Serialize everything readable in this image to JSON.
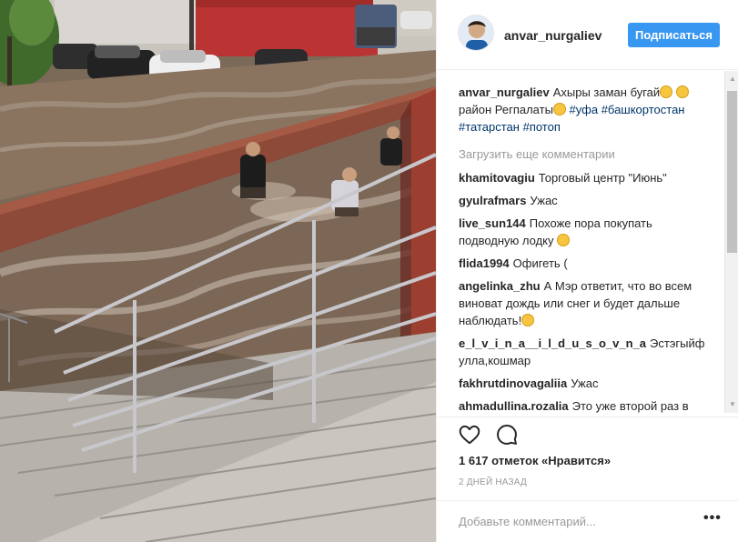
{
  "post": {
    "username": "anvar_nurgaliev",
    "follow_label": "Подписаться",
    "caption": {
      "username": "anvar_nurgaliev",
      "text_1": "Ахыры заман бугай",
      "text_2": "район Регпалаты",
      "hashtags": [
        "#уфа",
        "#башкортостан",
        "#татарстан",
        "#потоп"
      ]
    },
    "load_more_label": "Загрузить еще комментарии",
    "comments": [
      {
        "user": "khamitovagiu",
        "text": "Торговый центр \"Июнь\""
      },
      {
        "user": "gyulrafmars",
        "text": "Ужас"
      },
      {
        "user": "live_sun144",
        "text": "Похоже пора покупать подводную лодку"
      },
      {
        "user": "flida1994",
        "text": "Офигеть ("
      },
      {
        "user": "angelinka_zhu",
        "text": "А Мэр ответит, что во всем виноват дождь или снег и будет дальше наблюдать!"
      },
      {
        "user": "e_l_v_i_n_a__i_l_d_u_s_o_v_n_a",
        "text": "Эстэгыйфир улла,кошмар"
      },
      {
        "user": "fakhrutdinovagaliia",
        "text": "Ужас"
      },
      {
        "user": "ahmadullina.rozalia",
        "text": "Это уже второй раз в уфе"
      }
    ],
    "likes_label": "1 617 отметок «Нравится»",
    "timestamp": "2 ДНЕЙ НАЗАД",
    "comment_placeholder": "Добавьте комментарий...",
    "more_options_label": "•••"
  },
  "icons": {
    "like": "heart-icon",
    "comment": "speech-bubble-icon",
    "emoji": "flushed-face-emoji",
    "more": "more-options-icon"
  },
  "colors": {
    "follow_button": "#3897f0",
    "hashtag": "#003569",
    "muted_text": "#999999",
    "divider": "#efefef"
  }
}
